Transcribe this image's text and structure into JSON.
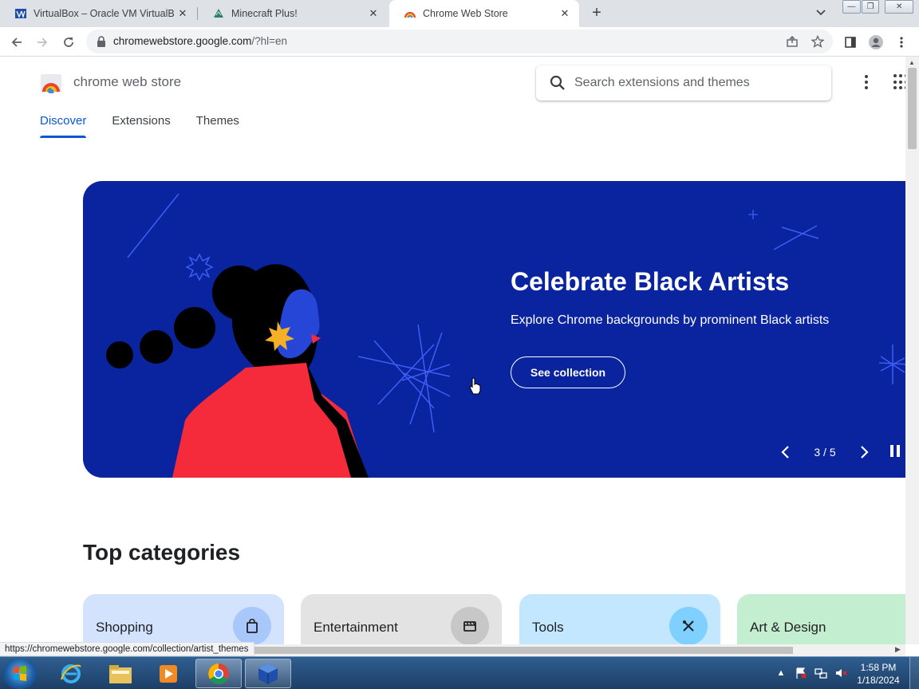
{
  "window": {
    "tabs": [
      {
        "title": "VirtualBox – Oracle VM VirtualBox",
        "favicon": "virtualbox-icon",
        "active": false
      },
      {
        "title": "Minecraft Plus!",
        "favicon": "minecraft-plus-icon",
        "active": false
      },
      {
        "title": "Chrome Web Store",
        "favicon": "chrome-web-store-icon",
        "active": true
      }
    ],
    "new_tab": "+",
    "controls": {
      "minimize": "—",
      "restore": "❐",
      "close": "✕"
    }
  },
  "toolbar": {
    "url_host": "chromewebstore.google.com",
    "url_path": "/?hl=en"
  },
  "store": {
    "logo_text": "chrome web store",
    "search_placeholder": "Search extensions and themes",
    "nav": [
      "Discover",
      "Extensions",
      "Themes"
    ],
    "nav_active": "Discover"
  },
  "banner": {
    "title": "Celebrate Black Artists",
    "subtitle": "Explore Chrome backgrounds by prominent Black artists",
    "button": "See collection",
    "counter": "3 / 5",
    "current_slide": 3,
    "total_slides": 5,
    "background": "#0a239f"
  },
  "top_categories": {
    "heading": "Top categories",
    "items": [
      {
        "label": "Shopping",
        "icon": "shopping-bag-icon",
        "bg": "#d3e3fd",
        "icon_bg": "#a8c7fa"
      },
      {
        "label": "Entertainment",
        "icon": "clapperboard-icon",
        "bg": "#e3e3e3",
        "icon_bg": "#c7c7c7"
      },
      {
        "label": "Tools",
        "icon": "tools-icon",
        "bg": "#c2e7ff",
        "icon_bg": "#7fcfff"
      },
      {
        "label": "Art & Design",
        "icon": "palette-icon",
        "bg": "#c4eed0",
        "icon_bg": "#6dd58c"
      }
    ]
  },
  "status_url": "https://chromewebstore.google.com/collection/artist_themes",
  "taskbar": {
    "time": "1:58 PM",
    "date": "1/18/2024",
    "apps": [
      "internet-explorer-icon",
      "file-explorer-icon",
      "media-player-icon",
      "chrome-icon",
      "virtualbox-icon"
    ]
  },
  "colors": {
    "accent": "#0b57d0",
    "banner_red": "#f52a3a",
    "banner_star": "#f6b026"
  }
}
